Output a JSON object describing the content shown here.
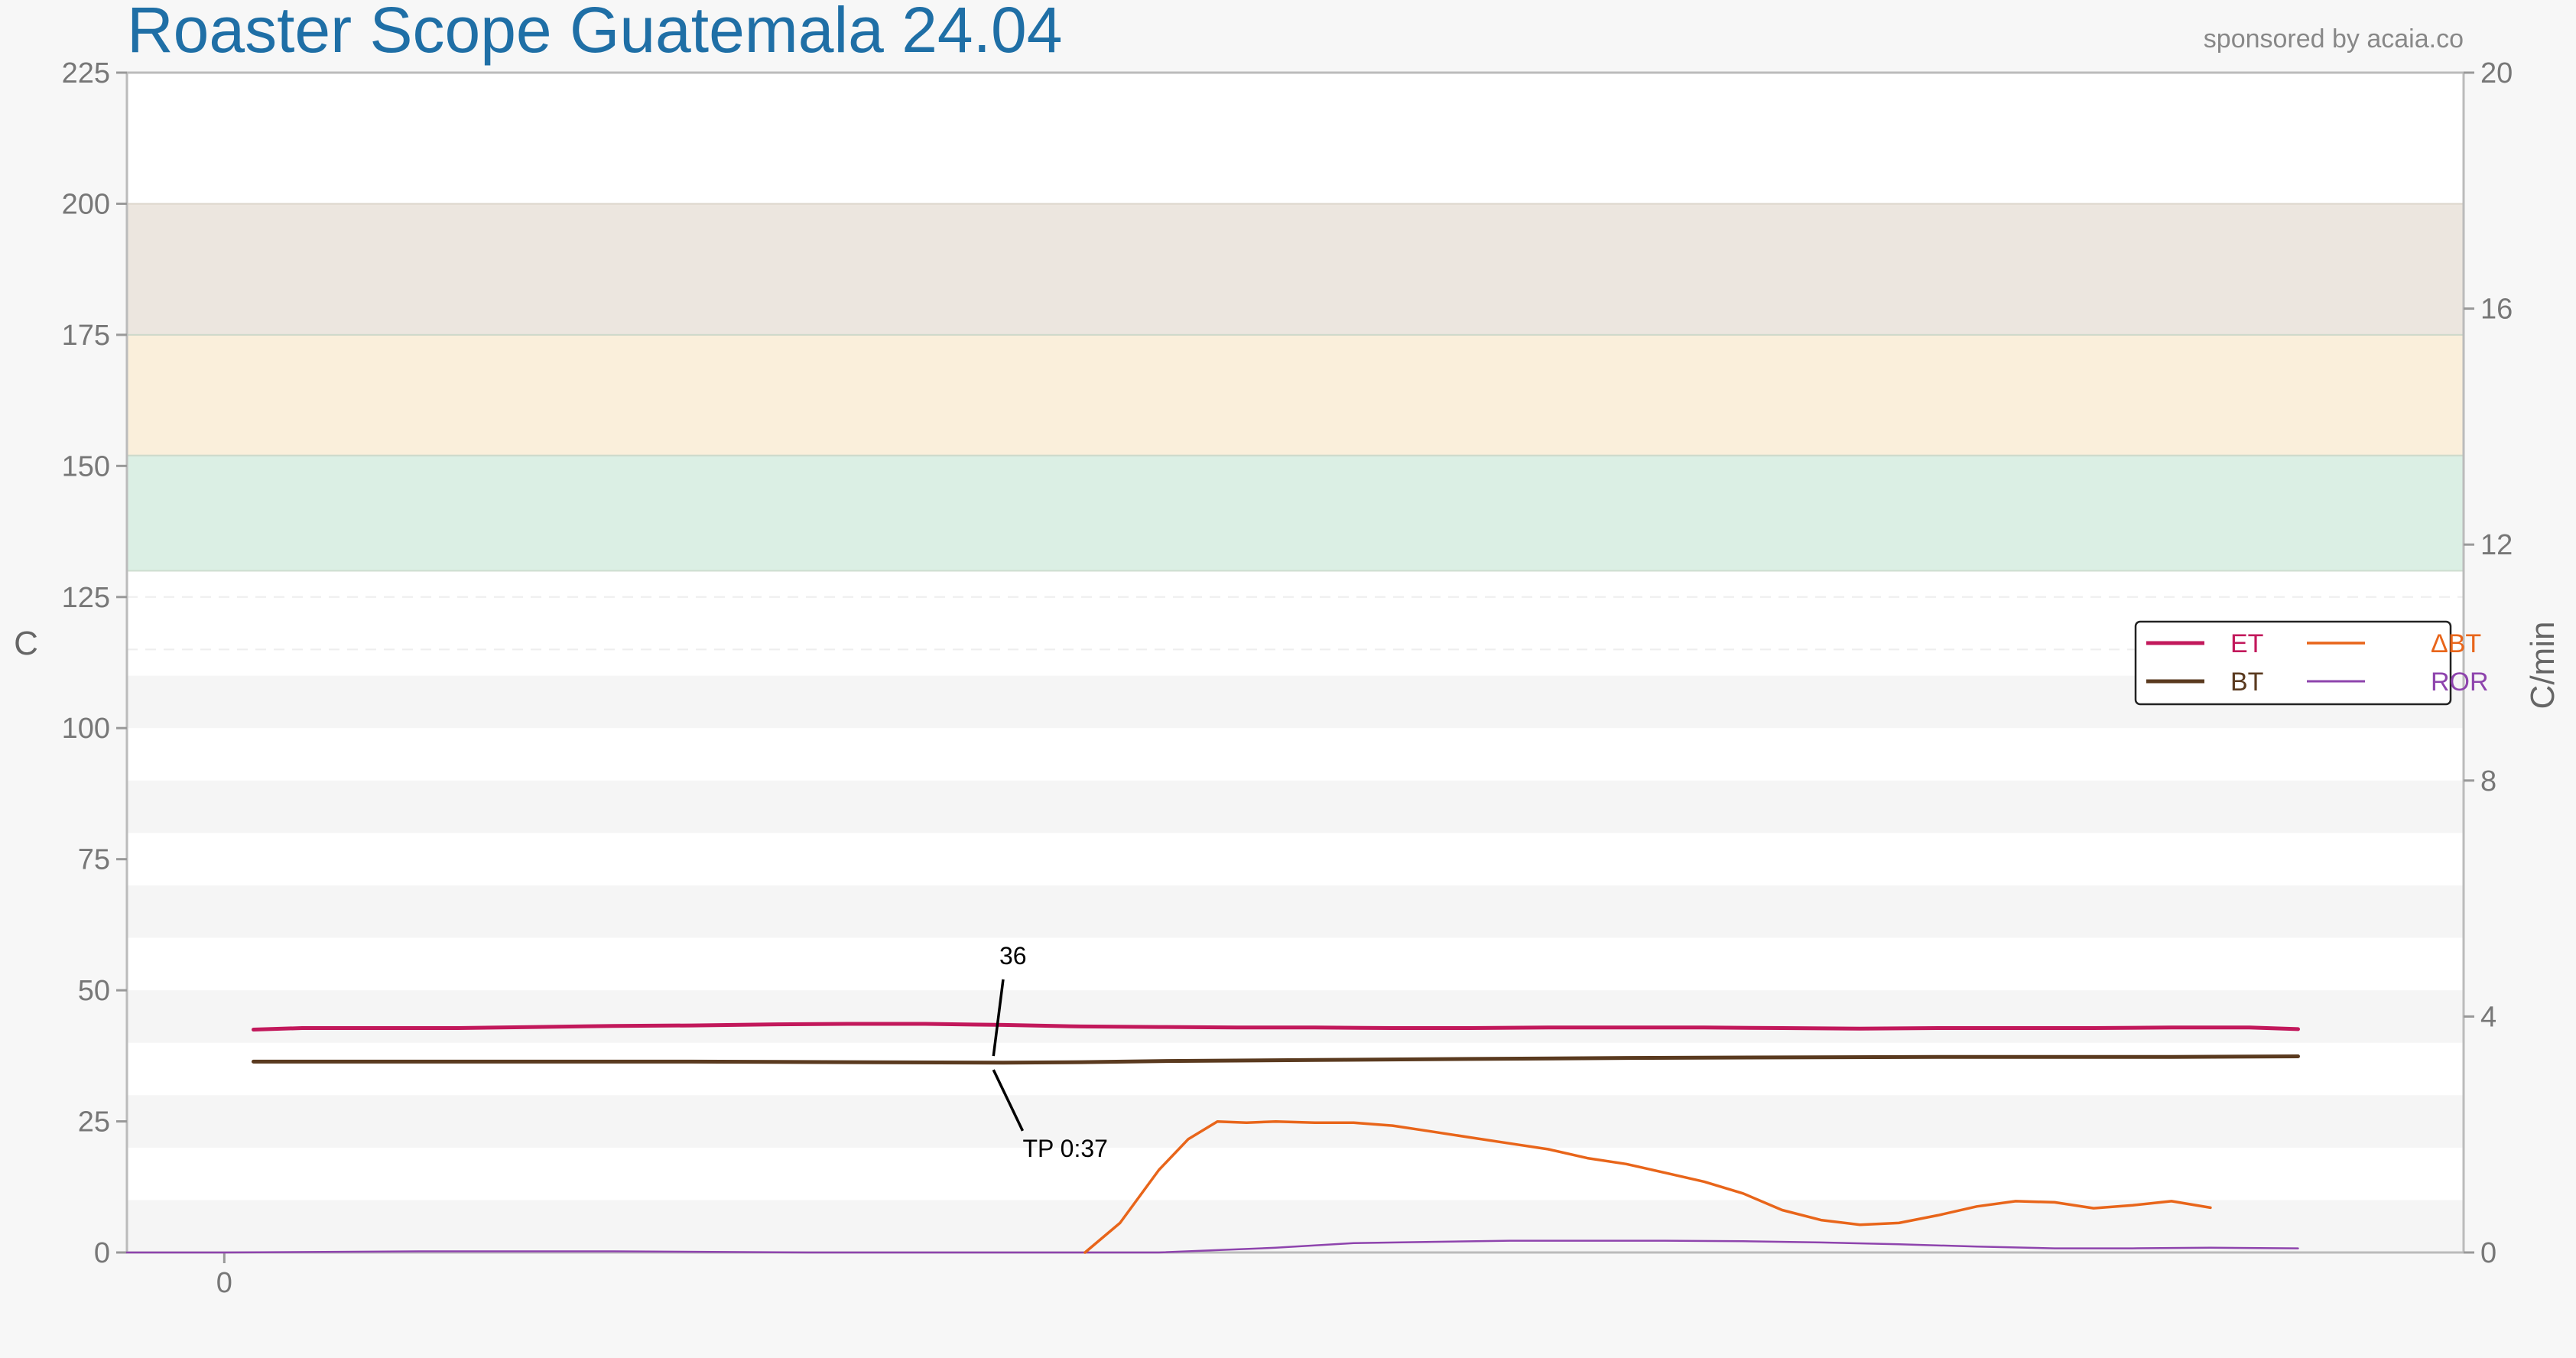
{
  "title": "Roaster Scope Guatemala 24.04",
  "sponsor": "sponsored by acaia.co",
  "colors": {
    "title": "#1f6fa6",
    "ET": "#c2185b",
    "BT": "#5a3a1f",
    "dBT": "#e8651a",
    "ROR": "#8e44ad",
    "band_green": "#dbefe4",
    "band_cream": "#faefdb",
    "band_taupe": "#ece6df"
  },
  "chart_data": {
    "type": "line",
    "title": "Roaster Scope Guatemala 24.04",
    "ylabel": "C",
    "y2label": "C/min",
    "ylim": [
      0,
      225
    ],
    "y2lim": [
      0,
      20
    ],
    "y_ticks": [
      0,
      25,
      50,
      75,
      100,
      125,
      150,
      175,
      200,
      225
    ],
    "y2_ticks": [
      0,
      4,
      8,
      12,
      16,
      20
    ],
    "x_ticks": [
      0
    ],
    "x_tick_labels": [
      "0"
    ],
    "xlim": [
      -5,
      115
    ],
    "bands": [
      {
        "from": 130,
        "to": 152,
        "color": "#dbefe4"
      },
      {
        "from": 152,
        "to": 175,
        "color": "#faefdb"
      },
      {
        "from": 175,
        "to": 200,
        "color": "#ece6df"
      }
    ],
    "legend": {
      "position": "right",
      "entries": [
        {
          "label": "ET",
          "key": "ET"
        },
        {
          "label": "ΔBT",
          "key": "dBT"
        },
        {
          "label": "BT",
          "key": "BT"
        },
        {
          "label": "ROR",
          "key": "ROR"
        }
      ]
    },
    "series": [
      {
        "name": "ET",
        "key": "ET",
        "axis": "left",
        "width": 5,
        "x": [
          1.5,
          4,
          8,
          12,
          16,
          20,
          24,
          28,
          32,
          36,
          40,
          44,
          48,
          52,
          56,
          60,
          64,
          68,
          72,
          76,
          80,
          84,
          88,
          92,
          96,
          100,
          104,
          106.5
        ],
        "y": [
          42.5,
          42.8,
          42.8,
          42.8,
          43.0,
          43.2,
          43.3,
          43.5,
          43.6,
          43.6,
          43.4,
          43.1,
          43.0,
          42.9,
          42.9,
          42.8,
          42.8,
          42.9,
          42.9,
          42.9,
          42.8,
          42.7,
          42.8,
          42.8,
          42.8,
          42.9,
          42.9,
          42.6
        ]
      },
      {
        "name": "BT",
        "key": "BT",
        "axis": "left",
        "width": 5,
        "x": [
          1.5,
          8,
          16,
          24,
          32,
          40,
          44,
          48,
          56,
          64,
          72,
          80,
          88,
          96,
          100,
          106.5
        ],
        "y": [
          36.4,
          36.4,
          36.4,
          36.4,
          36.3,
          36.2,
          36.3,
          36.5,
          36.7,
          36.9,
          37.1,
          37.2,
          37.3,
          37.3,
          37.3,
          37.4
        ]
      },
      {
        "name": "ΔBT",
        "key": "dBT",
        "axis": "right",
        "width": 3.5,
        "x": [
          44.2,
          46,
          48,
          49.5,
          51,
          52.5,
          54,
          56,
          58,
          60,
          62,
          64,
          66,
          68,
          70,
          72,
          74,
          76,
          78,
          80,
          82,
          84,
          86,
          88,
          90,
          92,
          94,
          96,
          98,
          100,
          102
        ],
        "y": [
          0.0,
          0.5,
          1.4,
          1.92,
          2.22,
          2.2,
          2.22,
          2.2,
          2.2,
          2.15,
          2.05,
          1.95,
          1.85,
          1.75,
          1.6,
          1.5,
          1.35,
          1.2,
          1.0,
          0.72,
          0.55,
          0.47,
          0.5,
          0.63,
          0.78,
          0.87,
          0.85,
          0.75,
          0.8,
          0.87,
          0.76
        ]
      },
      {
        "name": "ROR",
        "key": "ROR",
        "axis": "right",
        "width": 2.5,
        "x": [
          -5,
          0,
          10,
          20,
          30,
          40,
          48,
          54,
          58,
          62,
          66,
          70,
          74,
          78,
          82,
          86,
          90,
          94,
          98,
          102,
          106.5
        ],
        "y": [
          0.0,
          0.0,
          0.02,
          0.02,
          0.0,
          0.0,
          0.0,
          0.08,
          0.16,
          0.18,
          0.2,
          0.2,
          0.2,
          0.19,
          0.17,
          0.14,
          0.1,
          0.07,
          0.07,
          0.08,
          0.07
        ]
      }
    ],
    "annotations": [
      {
        "text": "36",
        "x": 39.5,
        "y": 36.3,
        "label_x": 40.0,
        "label_y": 55.0
      },
      {
        "text": "TP 0:37",
        "x": 39.5,
        "y": 36.0,
        "label_x": 41.0,
        "label_y": 20.0
      }
    ]
  }
}
